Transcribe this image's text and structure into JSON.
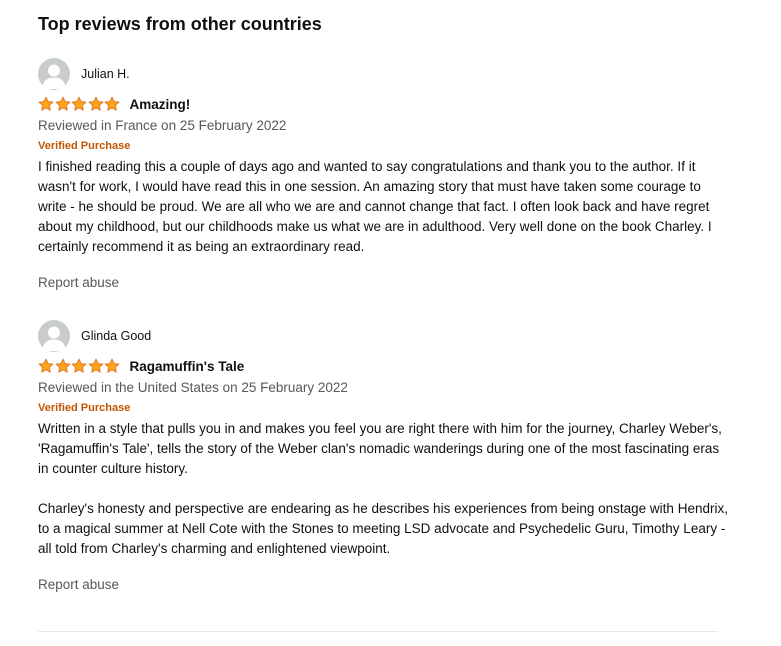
{
  "section": {
    "title": "Top reviews from other countries"
  },
  "reviews": [
    {
      "author": "Julian H.",
      "rating": 5,
      "rating_max": 5,
      "title": "Amazing!",
      "date_line": "Reviewed in France on 25 February 2022",
      "verified_label": "Verified Purchase",
      "body": [
        "I finished reading this a couple of days ago and wanted to say congratulations and thank you to the author. If it wasn't for work, I would have read this in one session. An amazing story that must have taken some courage to write - he should be proud. We are all who we are and cannot change that fact. I often look back and have regret about my childhood, but our childhoods make us what we are in adulthood. Very well done on the book Charley. I certainly recommend it as being an extraordinary read."
      ],
      "report_label": "Report abuse"
    },
    {
      "author": "Glinda Good",
      "rating": 5,
      "rating_max": 5,
      "title": "Ragamuffin's Tale",
      "date_line": "Reviewed in the United States on 25 February 2022",
      "verified_label": "Verified Purchase",
      "body": [
        "Written in a style that pulls you in and makes you feel you are right there with him for the journey, Charley Weber's, 'Ragamuffin's Tale', tells the story of the Weber clan's nomadic wanderings during one of the most fascinating eras in counter culture history.",
        "Charley's honesty and perspective are endearing as he describes his experiences from being onstage with Hendrix, to a magical summer at Nell Cote with the Stones to meeting LSD advocate and Psychedelic Guru, Timothy Leary - all told from Charley's charming and enlightened viewpoint."
      ],
      "report_label": "Report abuse"
    }
  ],
  "colors": {
    "star_fill": "#ffa41c",
    "star_stroke": "#de7921",
    "verified": "#c45500",
    "secondary_text": "#565959",
    "avatar_bg": "#c9cccc"
  },
  "icons": {
    "avatar": "default-avatar-icon",
    "star": "star-icon"
  }
}
